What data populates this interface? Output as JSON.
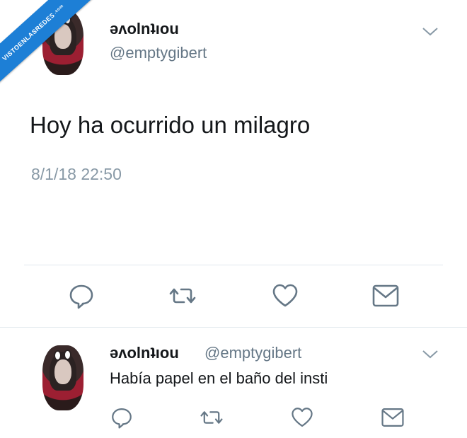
{
  "watermark": {
    "label": "VISTOENLASREDES",
    "suffix": ".com"
  },
  "tweet": {
    "display_name": "ǝʌolnʇıou",
    "handle": "@emptygibert",
    "text": "Hoy ha ocurrido un milagro",
    "timestamp": "8/1/18 22:50",
    "icons": [
      "chevron-down-icon",
      "reply-icon",
      "retweet-icon",
      "like-icon",
      "direct-message-icon"
    ]
  },
  "reply": {
    "display_name": "ǝʌolnʇıou",
    "handle": "@emptygibert",
    "text": "Había papel en el baño del insti"
  },
  "colors": {
    "text": "#14171a",
    "secondary": "#657786",
    "timestamp": "#8899a6",
    "icon": "#657786",
    "divider": "#e1e8ed",
    "banner": "#1d7fd6"
  }
}
